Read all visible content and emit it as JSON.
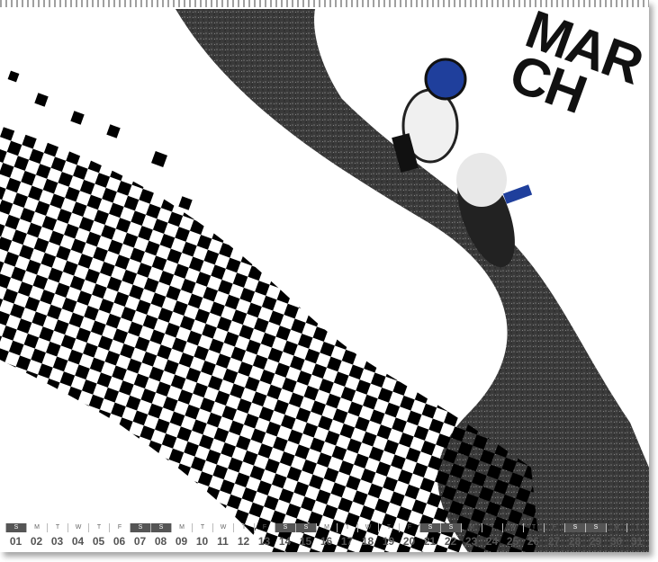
{
  "month": {
    "lines": [
      "MAR",
      "CH"
    ]
  },
  "days": [
    {
      "wd": "S",
      "d": "01",
      "weekend": true
    },
    {
      "wd": "M",
      "d": "02",
      "weekend": false
    },
    {
      "wd": "T",
      "d": "03",
      "weekend": false
    },
    {
      "wd": "W",
      "d": "04",
      "weekend": false
    },
    {
      "wd": "T",
      "d": "05",
      "weekend": false
    },
    {
      "wd": "F",
      "d": "06",
      "weekend": false
    },
    {
      "wd": "S",
      "d": "07",
      "weekend": true
    },
    {
      "wd": "S",
      "d": "08",
      "weekend": true
    },
    {
      "wd": "M",
      "d": "09",
      "weekend": false
    },
    {
      "wd": "T",
      "d": "10",
      "weekend": false
    },
    {
      "wd": "W",
      "d": "11",
      "weekend": false
    },
    {
      "wd": "T",
      "d": "12",
      "weekend": false
    },
    {
      "wd": "F",
      "d": "13",
      "weekend": false
    },
    {
      "wd": "S",
      "d": "14",
      "weekend": true
    },
    {
      "wd": "S",
      "d": "15",
      "weekend": true
    },
    {
      "wd": "M",
      "d": "16",
      "weekend": false
    },
    {
      "wd": "T",
      "d": "17",
      "weekend": false
    },
    {
      "wd": "W",
      "d": "18",
      "weekend": false
    },
    {
      "wd": "T",
      "d": "19",
      "weekend": false
    },
    {
      "wd": "F",
      "d": "20",
      "weekend": false
    },
    {
      "wd": "S",
      "d": "21",
      "weekend": true
    },
    {
      "wd": "S",
      "d": "22",
      "weekend": true
    },
    {
      "wd": "M",
      "d": "23",
      "weekend": false
    },
    {
      "wd": "T",
      "d": "24",
      "weekend": false
    },
    {
      "wd": "W",
      "d": "25",
      "weekend": false
    },
    {
      "wd": "T",
      "d": "26",
      "weekend": false
    },
    {
      "wd": "F",
      "d": "27",
      "weekend": false
    },
    {
      "wd": "S",
      "d": "28",
      "weekend": true
    },
    {
      "wd": "S",
      "d": "29",
      "weekend": true
    },
    {
      "wd": "M",
      "d": "30",
      "weekend": false
    },
    {
      "wd": "T",
      "d": "31",
      "weekend": false
    }
  ]
}
